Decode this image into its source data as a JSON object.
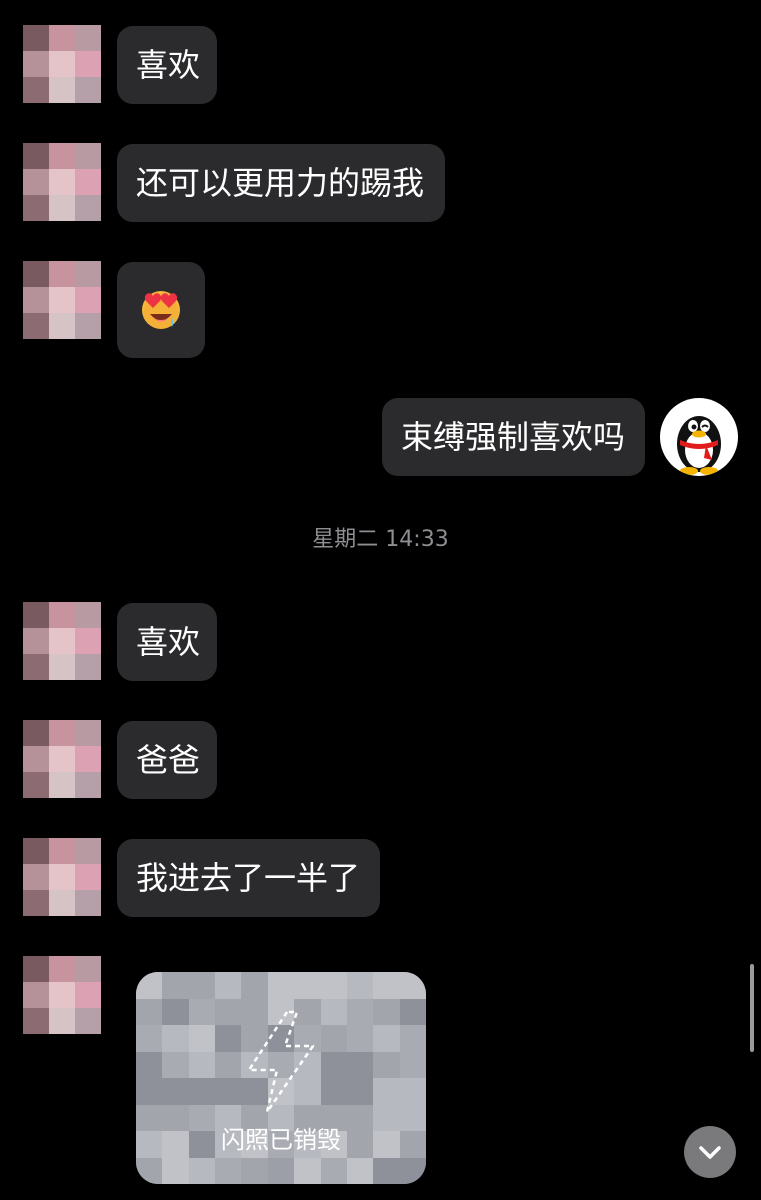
{
  "messages": [
    {
      "side": "left",
      "text": "喜欢"
    },
    {
      "side": "left",
      "text": "还可以更用力的踢我"
    },
    {
      "side": "left",
      "emoji": "heart-eyes-emoji"
    },
    {
      "side": "right",
      "text": "束缚强制喜欢吗"
    },
    {
      "side": "left",
      "text": "喜欢"
    },
    {
      "side": "left",
      "text": "爸爸"
    },
    {
      "side": "left",
      "text": "我进去了一半了"
    }
  ],
  "timestamp": "星期二 14:33",
  "flash_photo": {
    "label": "闪照已销毁",
    "icon": "lightning-icon"
  },
  "self_avatar_icon": "qq-penguin-icon",
  "scroll_button_icon": "chevron-down-icon",
  "colors": {
    "background": "#000000",
    "bubble": "#2b2b2d",
    "timestamp": "#8e8e93"
  }
}
